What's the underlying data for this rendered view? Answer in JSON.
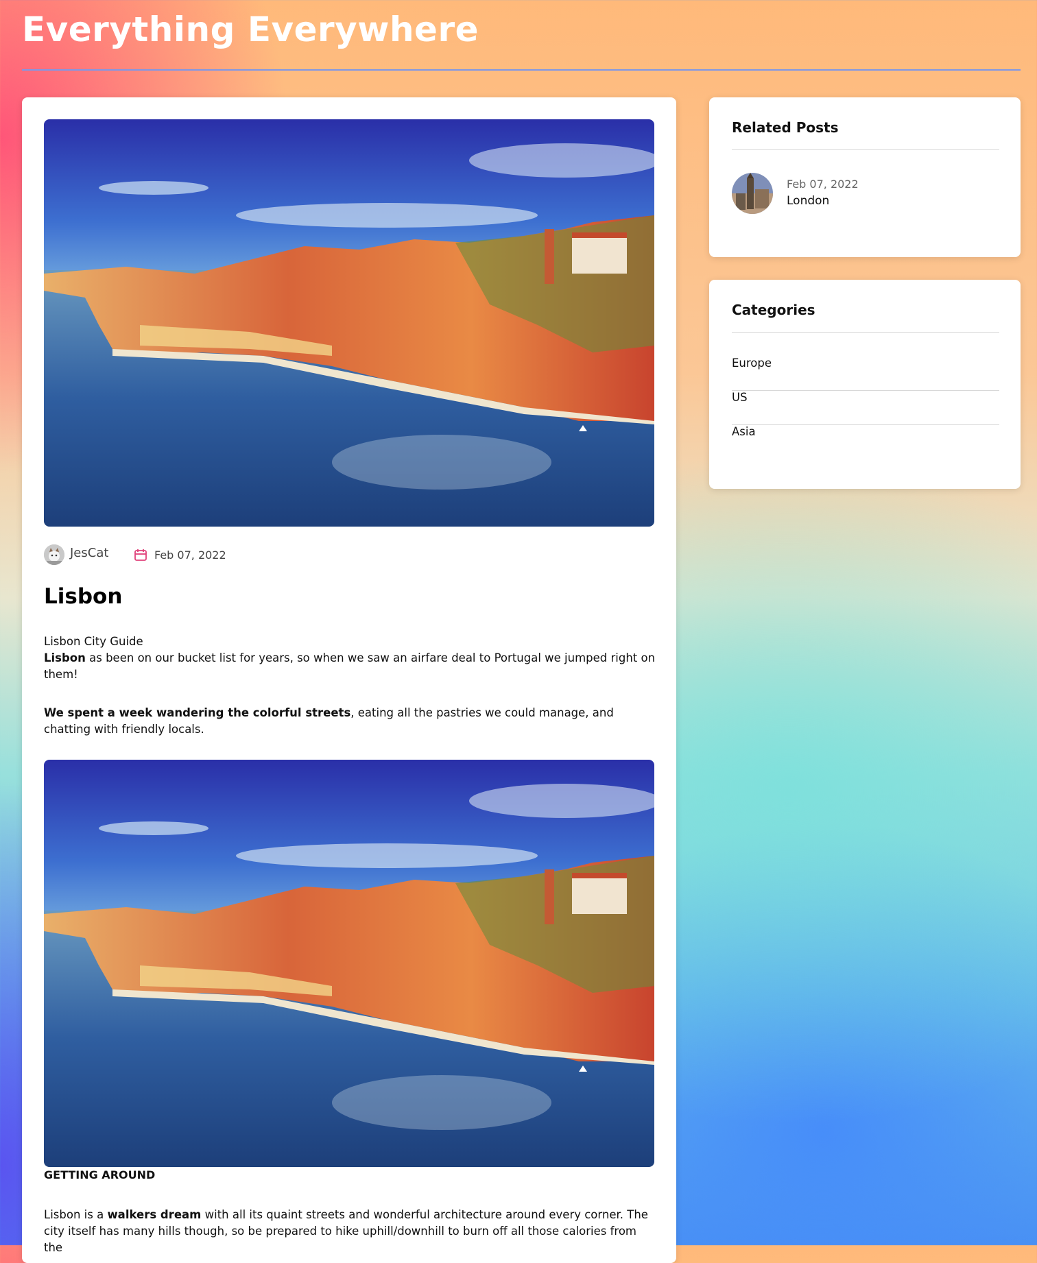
{
  "site": {
    "title": "Everything Everywhere"
  },
  "post": {
    "author": "JesCat",
    "date": "Feb 07, 2022",
    "title": "Lisbon",
    "subtitle": "Lisbon City Guide",
    "para1_bold": "Lisbon",
    "para1_rest": " as been on our bucket list for years, so when we saw an airfare deal to Portugal we jumped right on them!",
    "para2_bold": "We spent a week wandering the colorful streets",
    "para2_rest": ", eating all the pastries we could manage, and chatting with friendly locals.",
    "section_heading": "GETTING AROUND",
    "para3_start": "Lisbon is a ",
    "para3_bold": "walkers dream",
    "para3_rest": " with all its quaint streets and wonderful architecture around every corner. The city itself has many hills though, so be prepared to hike uphill/downhill to burn off all those calories from the",
    "image_alt": "Lisbon riverside cityscape"
  },
  "related": {
    "heading": "Related Posts",
    "items": [
      {
        "date": "Feb 07, 2022",
        "title": "London"
      }
    ]
  },
  "categories": {
    "heading": "Categories",
    "items": [
      "Europe",
      "US",
      "Asia"
    ]
  },
  "colors": {
    "title_rule": "#7f97e6",
    "calendar_icon": "#e0407a"
  },
  "icons": [
    "cat-avatar-icon",
    "calendar-icon"
  ]
}
